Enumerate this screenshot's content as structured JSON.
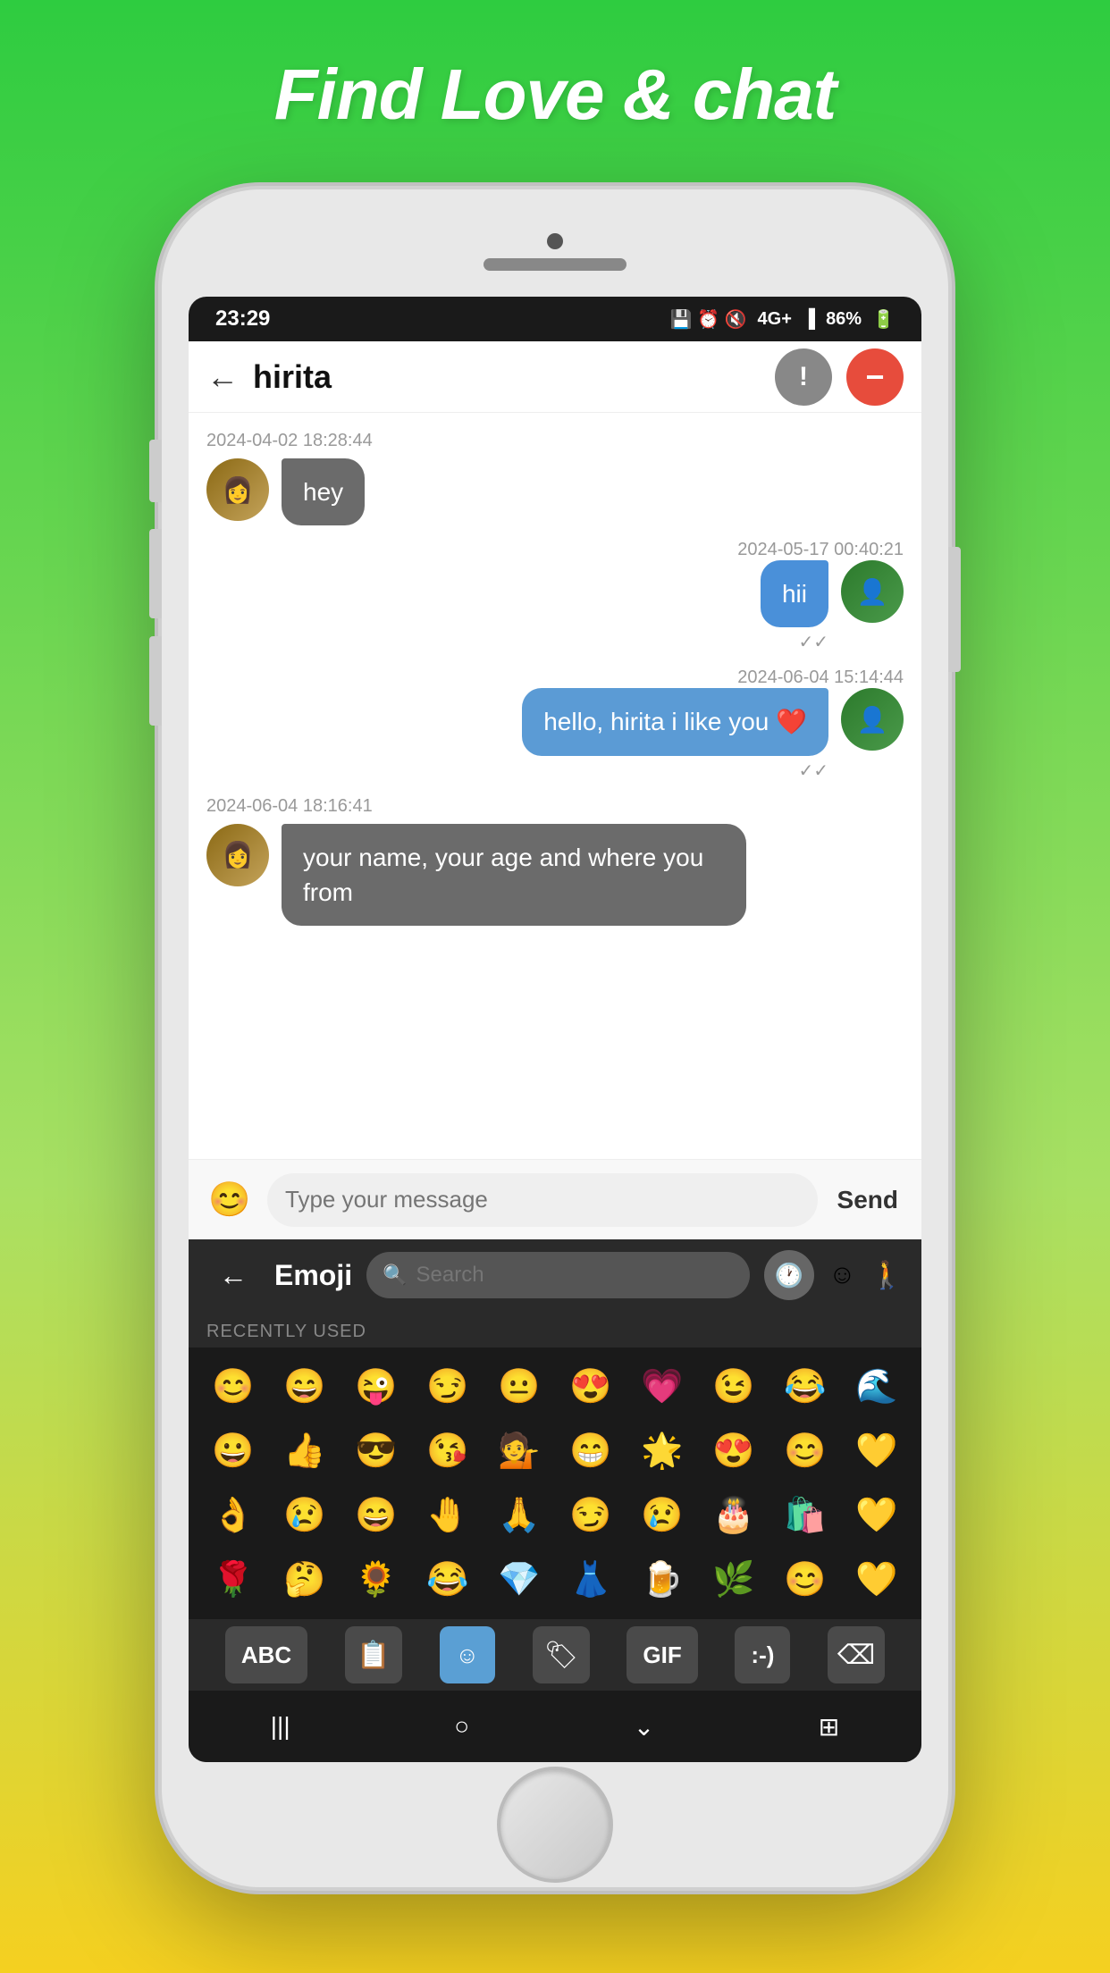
{
  "app": {
    "title": "Find Love & chat"
  },
  "status_bar": {
    "time": "23:29",
    "battery": "86%",
    "signal": "4G+"
  },
  "chat_header": {
    "username": "hirita",
    "back_label": "←"
  },
  "messages": [
    {
      "id": "msg1",
      "timestamp": "2024-04-02 18:28:44",
      "side": "left",
      "text": "hey"
    },
    {
      "id": "msg2",
      "timestamp": "2024-05-17 00:40:21",
      "side": "right",
      "text": "hii"
    },
    {
      "id": "msg3",
      "timestamp": "2024-06-04 15:14:44",
      "side": "right",
      "text": "hello, hirita i like you ❤️"
    },
    {
      "id": "msg4",
      "timestamp": "2024-06-04 18:16:41",
      "side": "left",
      "text": "your name, your age and where you from"
    }
  ],
  "message_input": {
    "placeholder": "Type your message",
    "send_label": "Send"
  },
  "emoji_keyboard": {
    "title": "Emoji",
    "search_placeholder": "Search",
    "recently_used_label": "RECENTLY USED",
    "emojis_row1": [
      "😊",
      "😄",
      "😜",
      "😏",
      "😐",
      "😍",
      "💗",
      "😉",
      "😂",
      "🌊"
    ],
    "emojis_row2": [
      "😀",
      "👍",
      "😎",
      "😘",
      "💁",
      "😁",
      "🌟",
      "😍",
      "😊",
      "💛"
    ],
    "emojis_row3": [
      "👌",
      "😢",
      "😄",
      "🤚",
      "🙏",
      "😏",
      "😢",
      "🎂",
      "🛍️",
      "💛"
    ],
    "emojis_row4": [
      "🌹",
      "🤔",
      "🌻",
      "😂",
      "💎",
      "👗",
      "🍺",
      "🌿",
      "😊",
      "💛"
    ]
  },
  "keyboard_bottom": {
    "abc_label": "ABC",
    "gif_label": "GIF",
    "text_label": ":-)"
  },
  "nav_bar": {
    "back_label": "|||",
    "home_label": "○",
    "down_label": "⌄",
    "grid_label": "⊞"
  }
}
